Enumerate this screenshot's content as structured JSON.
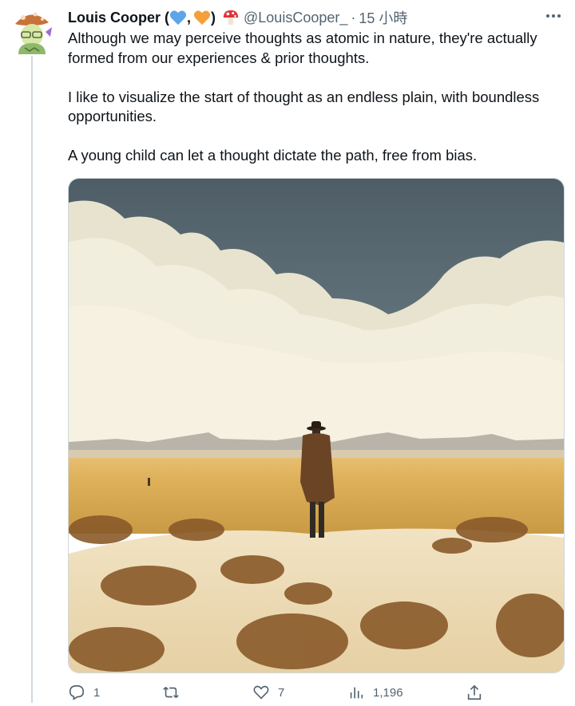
{
  "tweet": {
    "author_name": "Louis Cooper (",
    "author_sep": ",",
    "author_close": ")",
    "handle": "@LouisCooper_",
    "separator": "·",
    "time": "15 小時",
    "paragraphs": [
      "Although we may perceive thoughts as atomic in nature, they're actually formed from our experiences & prior thoughts.",
      "I like to visualize the start of thought as an endless plain, with boundless opportunities.",
      "A young child can let a thought dictate the path, free from bias."
    ],
    "icons": {
      "heart_blue": "blue-heart-icon",
      "heart_orange": "orange-heart-icon",
      "mushroom": "mushroom-icon",
      "more": "more-icon"
    }
  },
  "actions": {
    "reply_count": "1",
    "retweet_count": "",
    "like_count": "7",
    "views_count": "1,196"
  },
  "colors": {
    "secondary_text": "#536471",
    "thread_line": "#cfd9de"
  }
}
